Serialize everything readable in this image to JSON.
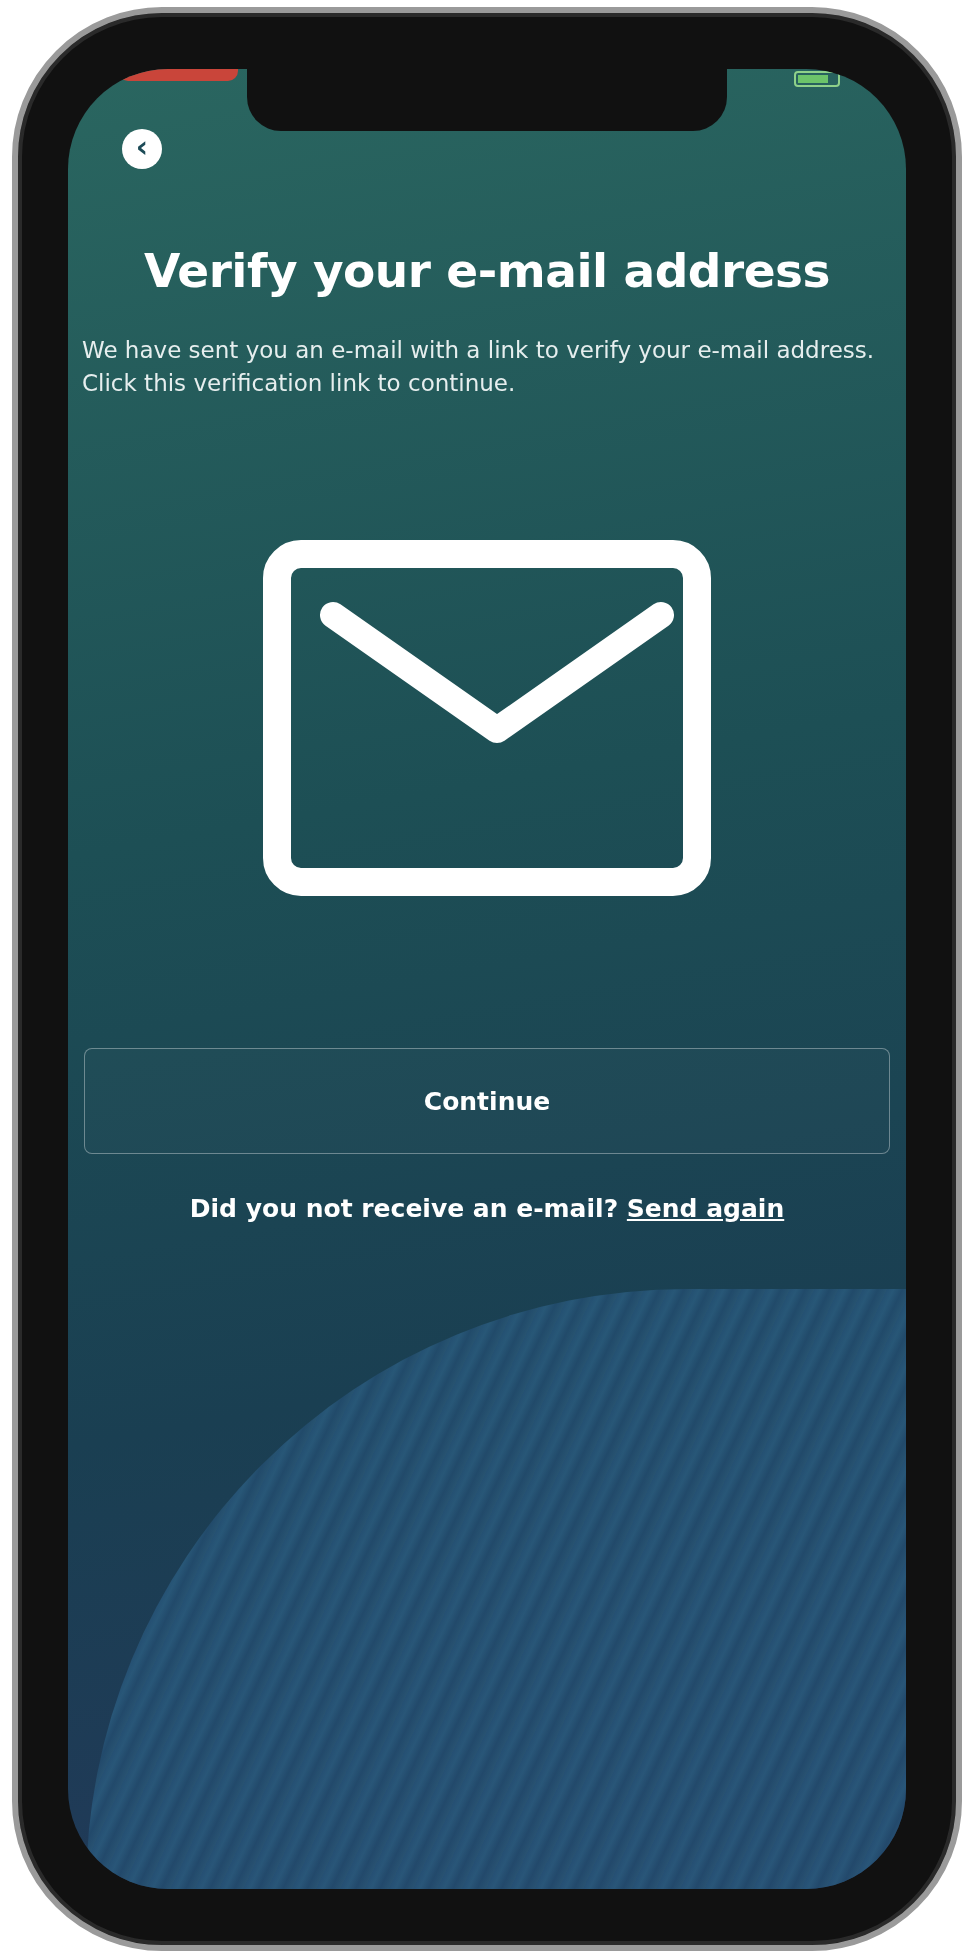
{
  "screen": {
    "back_button": {
      "label": "‹"
    },
    "title": "Verify your e-mail address",
    "message": "We have sent you an e-mail with a link to verify your e-mail address. Click this verification link to continue.",
    "primary_button": {
      "label": "Continue"
    },
    "resend": {
      "prompt": "Did you not receive an e-mail?",
      "link": "Send again"
    }
  }
}
